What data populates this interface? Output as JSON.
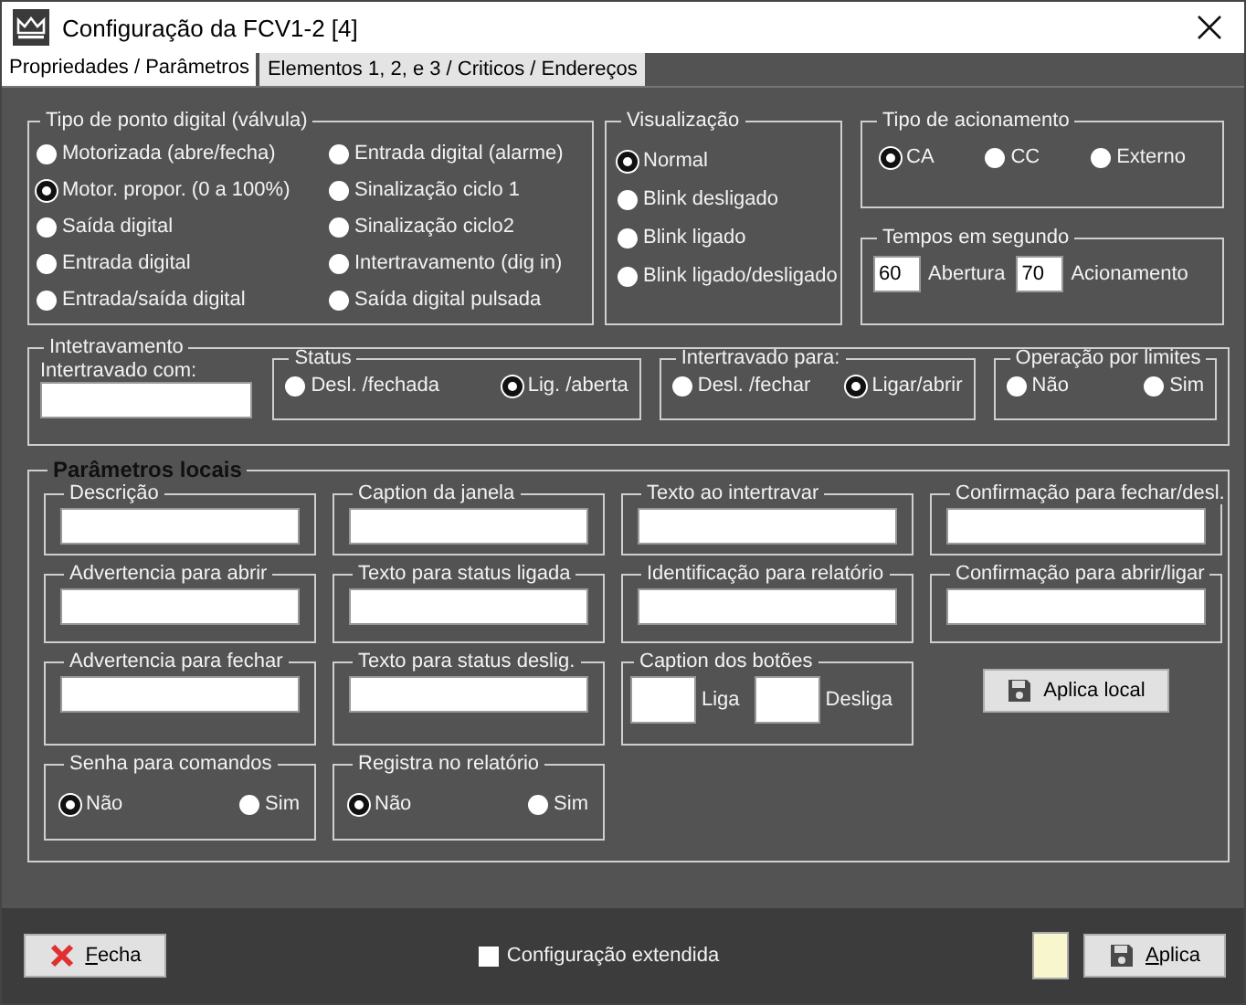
{
  "window": {
    "title": "Configuração da FCV1-2  [4]"
  },
  "tabs": [
    {
      "label": "Propriedades / Parâmetros",
      "selected": true
    },
    {
      "label": "Elementos 1, 2, e 3 / Criticos / Endereços",
      "selected": false
    }
  ],
  "tipo_ponto": {
    "title": "Tipo de ponto digital (válvula)",
    "options": [
      {
        "label": "Motorizada (abre/fecha)",
        "selected": false
      },
      {
        "label": "Motor. propor.  (0 a 100%)",
        "selected": true
      },
      {
        "label": "Saída digital",
        "selected": false
      },
      {
        "label": "Entrada digital",
        "selected": false
      },
      {
        "label": "Entrada/saída digital",
        "selected": false
      },
      {
        "label": "Entrada digital (alarme)",
        "selected": false
      },
      {
        "label": "Sinalização ciclo 1",
        "selected": false
      },
      {
        "label": "Sinalização ciclo2",
        "selected": false
      },
      {
        "label": "Intertravamento (dig in)",
        "selected": false
      },
      {
        "label": "Saída digital pulsada",
        "selected": false
      }
    ]
  },
  "visualizacao": {
    "title": "Visualização",
    "options": [
      {
        "label": "Normal",
        "selected": true
      },
      {
        "label": "Blink desligado",
        "selected": false
      },
      {
        "label": "Blink ligado",
        "selected": false
      },
      {
        "label": "Blink ligado/desligado",
        "selected": false
      }
    ]
  },
  "tipo_acionamento": {
    "title": "Tipo de acionamento",
    "options": [
      {
        "label": "CA",
        "selected": true
      },
      {
        "label": "CC",
        "selected": false
      },
      {
        "label": "Externo",
        "selected": false
      }
    ]
  },
  "tempos": {
    "title": "Tempos em segundo",
    "items": [
      {
        "kind": "input",
        "value": "60"
      },
      {
        "kind": "text",
        "text": "Abertura"
      },
      {
        "kind": "input",
        "value": "70"
      },
      {
        "kind": "text",
        "text": "Acionamento"
      }
    ]
  },
  "intertravamento": {
    "title": "Intetravamento",
    "field_label": "Intertravado com:",
    "groups": [
      {
        "title": "Status",
        "options": [
          {
            "label": "Desl. /fechada",
            "selected": false
          },
          {
            "label": "Lig. /aberta",
            "selected": true
          }
        ]
      },
      {
        "title": "Intertravado para:",
        "options": [
          {
            "label": "Desl. /fechar",
            "selected": false
          },
          {
            "label": "Ligar/abrir",
            "selected": true
          }
        ]
      },
      {
        "title": "Operação por limites",
        "options": [
          {
            "label": "Não",
            "selected": false
          },
          {
            "label": "Sim",
            "selected": false
          }
        ]
      }
    ]
  },
  "parametros_locais": {
    "title": "Parâmetros locais",
    "text_fields": [
      {
        "label": "Descrição"
      },
      {
        "label": "Caption da janela"
      },
      {
        "label": "Texto ao intertravar"
      },
      {
        "label": "Confirmação para fechar/desl."
      },
      {
        "label": "Advertencia para abrir"
      },
      {
        "label": "Texto para status ligada"
      },
      {
        "label": "Identificação para relatório"
      },
      {
        "label": "Confirmação para abrir/ligar"
      },
      {
        "label": "Advertencia para fechar"
      },
      {
        "label": "Texto para status deslig."
      }
    ],
    "caption_botoes": {
      "title": "Caption dos botões",
      "fields": [
        {
          "label": "Liga"
        },
        {
          "label": "Desliga"
        }
      ]
    },
    "apply_button": "Aplica local",
    "radio_groups": [
      {
        "title": "Senha para comandos",
        "options": [
          {
            "label": "Não",
            "selected": true
          },
          {
            "label": "Sim",
            "selected": false
          }
        ]
      },
      {
        "title": "Registra no relatório",
        "options": [
          {
            "label": "Não",
            "selected": true
          },
          {
            "label": "Sim",
            "selected": false
          }
        ]
      }
    ]
  },
  "footer": {
    "close_button": "Fecha",
    "checkbox": {
      "label": "Configuração extendida",
      "checked": false
    },
    "apply_button": "Aplica"
  }
}
